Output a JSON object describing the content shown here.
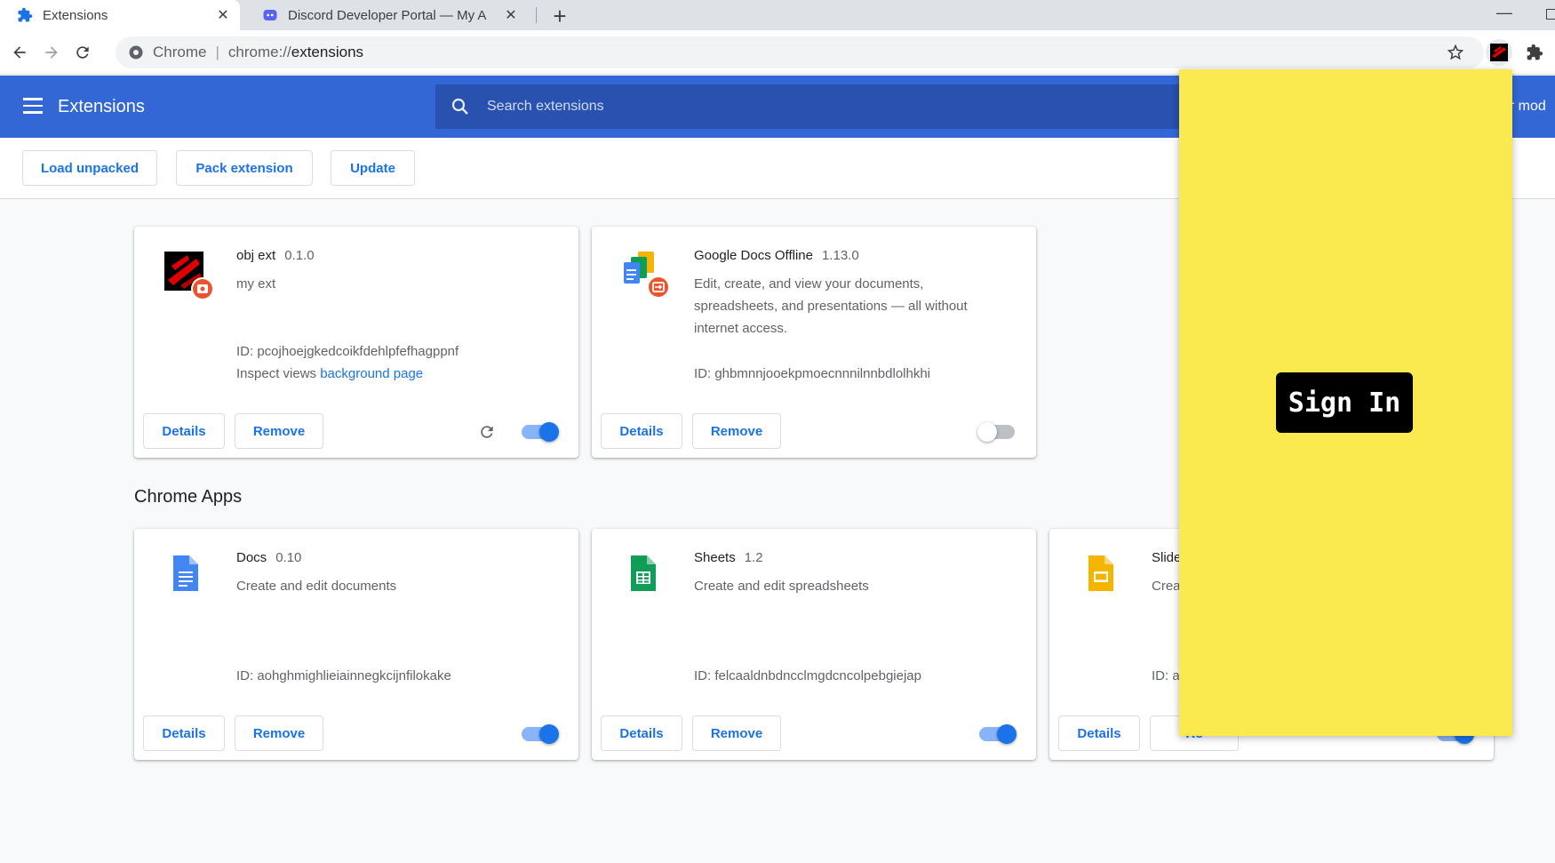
{
  "tabs": [
    {
      "title": "Extensions",
      "active": true,
      "icon": "puzzle-icon"
    },
    {
      "title": "Discord Developer Portal — My A",
      "active": false,
      "icon": "discord-icon"
    }
  ],
  "omnibox": {
    "site": "Chrome",
    "scheme": "chrome://",
    "path": "extensions"
  },
  "header": {
    "title": "Extensions",
    "search_placeholder": "Search extensions",
    "devmode_label": "er mod"
  },
  "actions": {
    "load_unpacked": "Load unpacked",
    "pack_extension": "Pack extension",
    "update": "Update"
  },
  "extensions": [
    {
      "name": "obj ext",
      "version": "0.1.0",
      "description": "my ext",
      "id_text": "ID: pcojhoejgkedcoikfdehlpfefhagppnf",
      "inspect_label": "Inspect views ",
      "inspect_link": "background page",
      "enabled": true,
      "details_label": "Details",
      "remove_label": "Remove"
    },
    {
      "name": "Google Docs Offline",
      "version": "1.13.0",
      "description": "Edit, create, and view your documents, spreadsheets, and presentations — all without internet access.",
      "id_text": "ID: ghbmnnjooekpmoecnnnilnnbdlolhkhi",
      "enabled": false,
      "details_label": "Details",
      "remove_label": "Remove"
    }
  ],
  "apps_section_title": "Chrome Apps",
  "apps": [
    {
      "name": "Docs",
      "version": "0.10",
      "description": "Create and edit documents",
      "id_text": "ID: aohghmighlieiainnegkcijnfilokake",
      "enabled": true,
      "details_label": "Details",
      "remove_label": "Remove"
    },
    {
      "name": "Sheets",
      "version": "1.2",
      "description": "Create and edit spreadsheets",
      "id_text": "ID: felcaaldnbdncclmgdcncolpebgiejap",
      "enabled": true,
      "details_label": "Details",
      "remove_label": "Remove"
    },
    {
      "name": "Slide",
      "version": "",
      "description": "Crea",
      "id_text": "ID: a",
      "enabled": true,
      "details_label": "Details",
      "remove_label": "Re"
    }
  ],
  "popup": {
    "signin_label": "Sign In",
    "background": "#fbea4f"
  },
  "colors": {
    "accent": "#1a73e8",
    "header": "#3367d6",
    "searchbar": "#2851b0"
  }
}
